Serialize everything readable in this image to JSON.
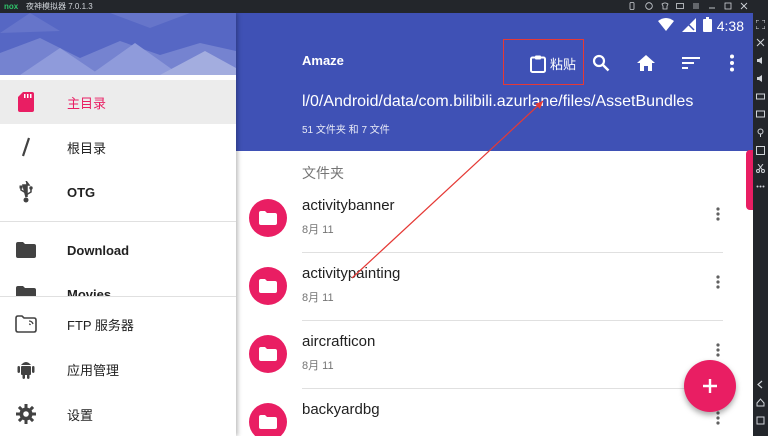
{
  "emulator": {
    "logo": "nox",
    "title": "夜神模拟器 7.0.1.3"
  },
  "statusbar": {
    "time": "4:38"
  },
  "appbar": {
    "title": "Amaze",
    "paste_label": "粘贴",
    "path": "l/0/Android/data/com.bilibili.azurlane/files/AssetBundles",
    "counts": "51 文件夹 和 7 文件"
  },
  "drawer": {
    "items": [
      {
        "label": "主目录",
        "icon": "sd-card-icon"
      },
      {
        "label": "根目录",
        "icon": "root-slash-icon"
      },
      {
        "label": "OTG",
        "icon": "usb-icon"
      },
      {
        "label": "Download",
        "icon": "folder-icon"
      },
      {
        "label": "Movies",
        "icon": "folder-icon"
      },
      {
        "label": "FTP 服务器",
        "icon": "ftp-folder-icon"
      },
      {
        "label": "应用管理",
        "icon": "android-icon"
      },
      {
        "label": "设置",
        "icon": "settings-gear-icon"
      }
    ]
  },
  "list": {
    "section_title": "文件夹",
    "rows": [
      {
        "name": "activitybanner",
        "date": "8月 11"
      },
      {
        "name": "activitypainting",
        "date": "8月 11"
      },
      {
        "name": "aircrafticon",
        "date": "8月 11"
      },
      {
        "name": "backyardbg",
        "date": ""
      }
    ]
  },
  "colors": {
    "primary": "#3f51b5",
    "accent": "#e91e63",
    "annotation": "#e53935"
  }
}
